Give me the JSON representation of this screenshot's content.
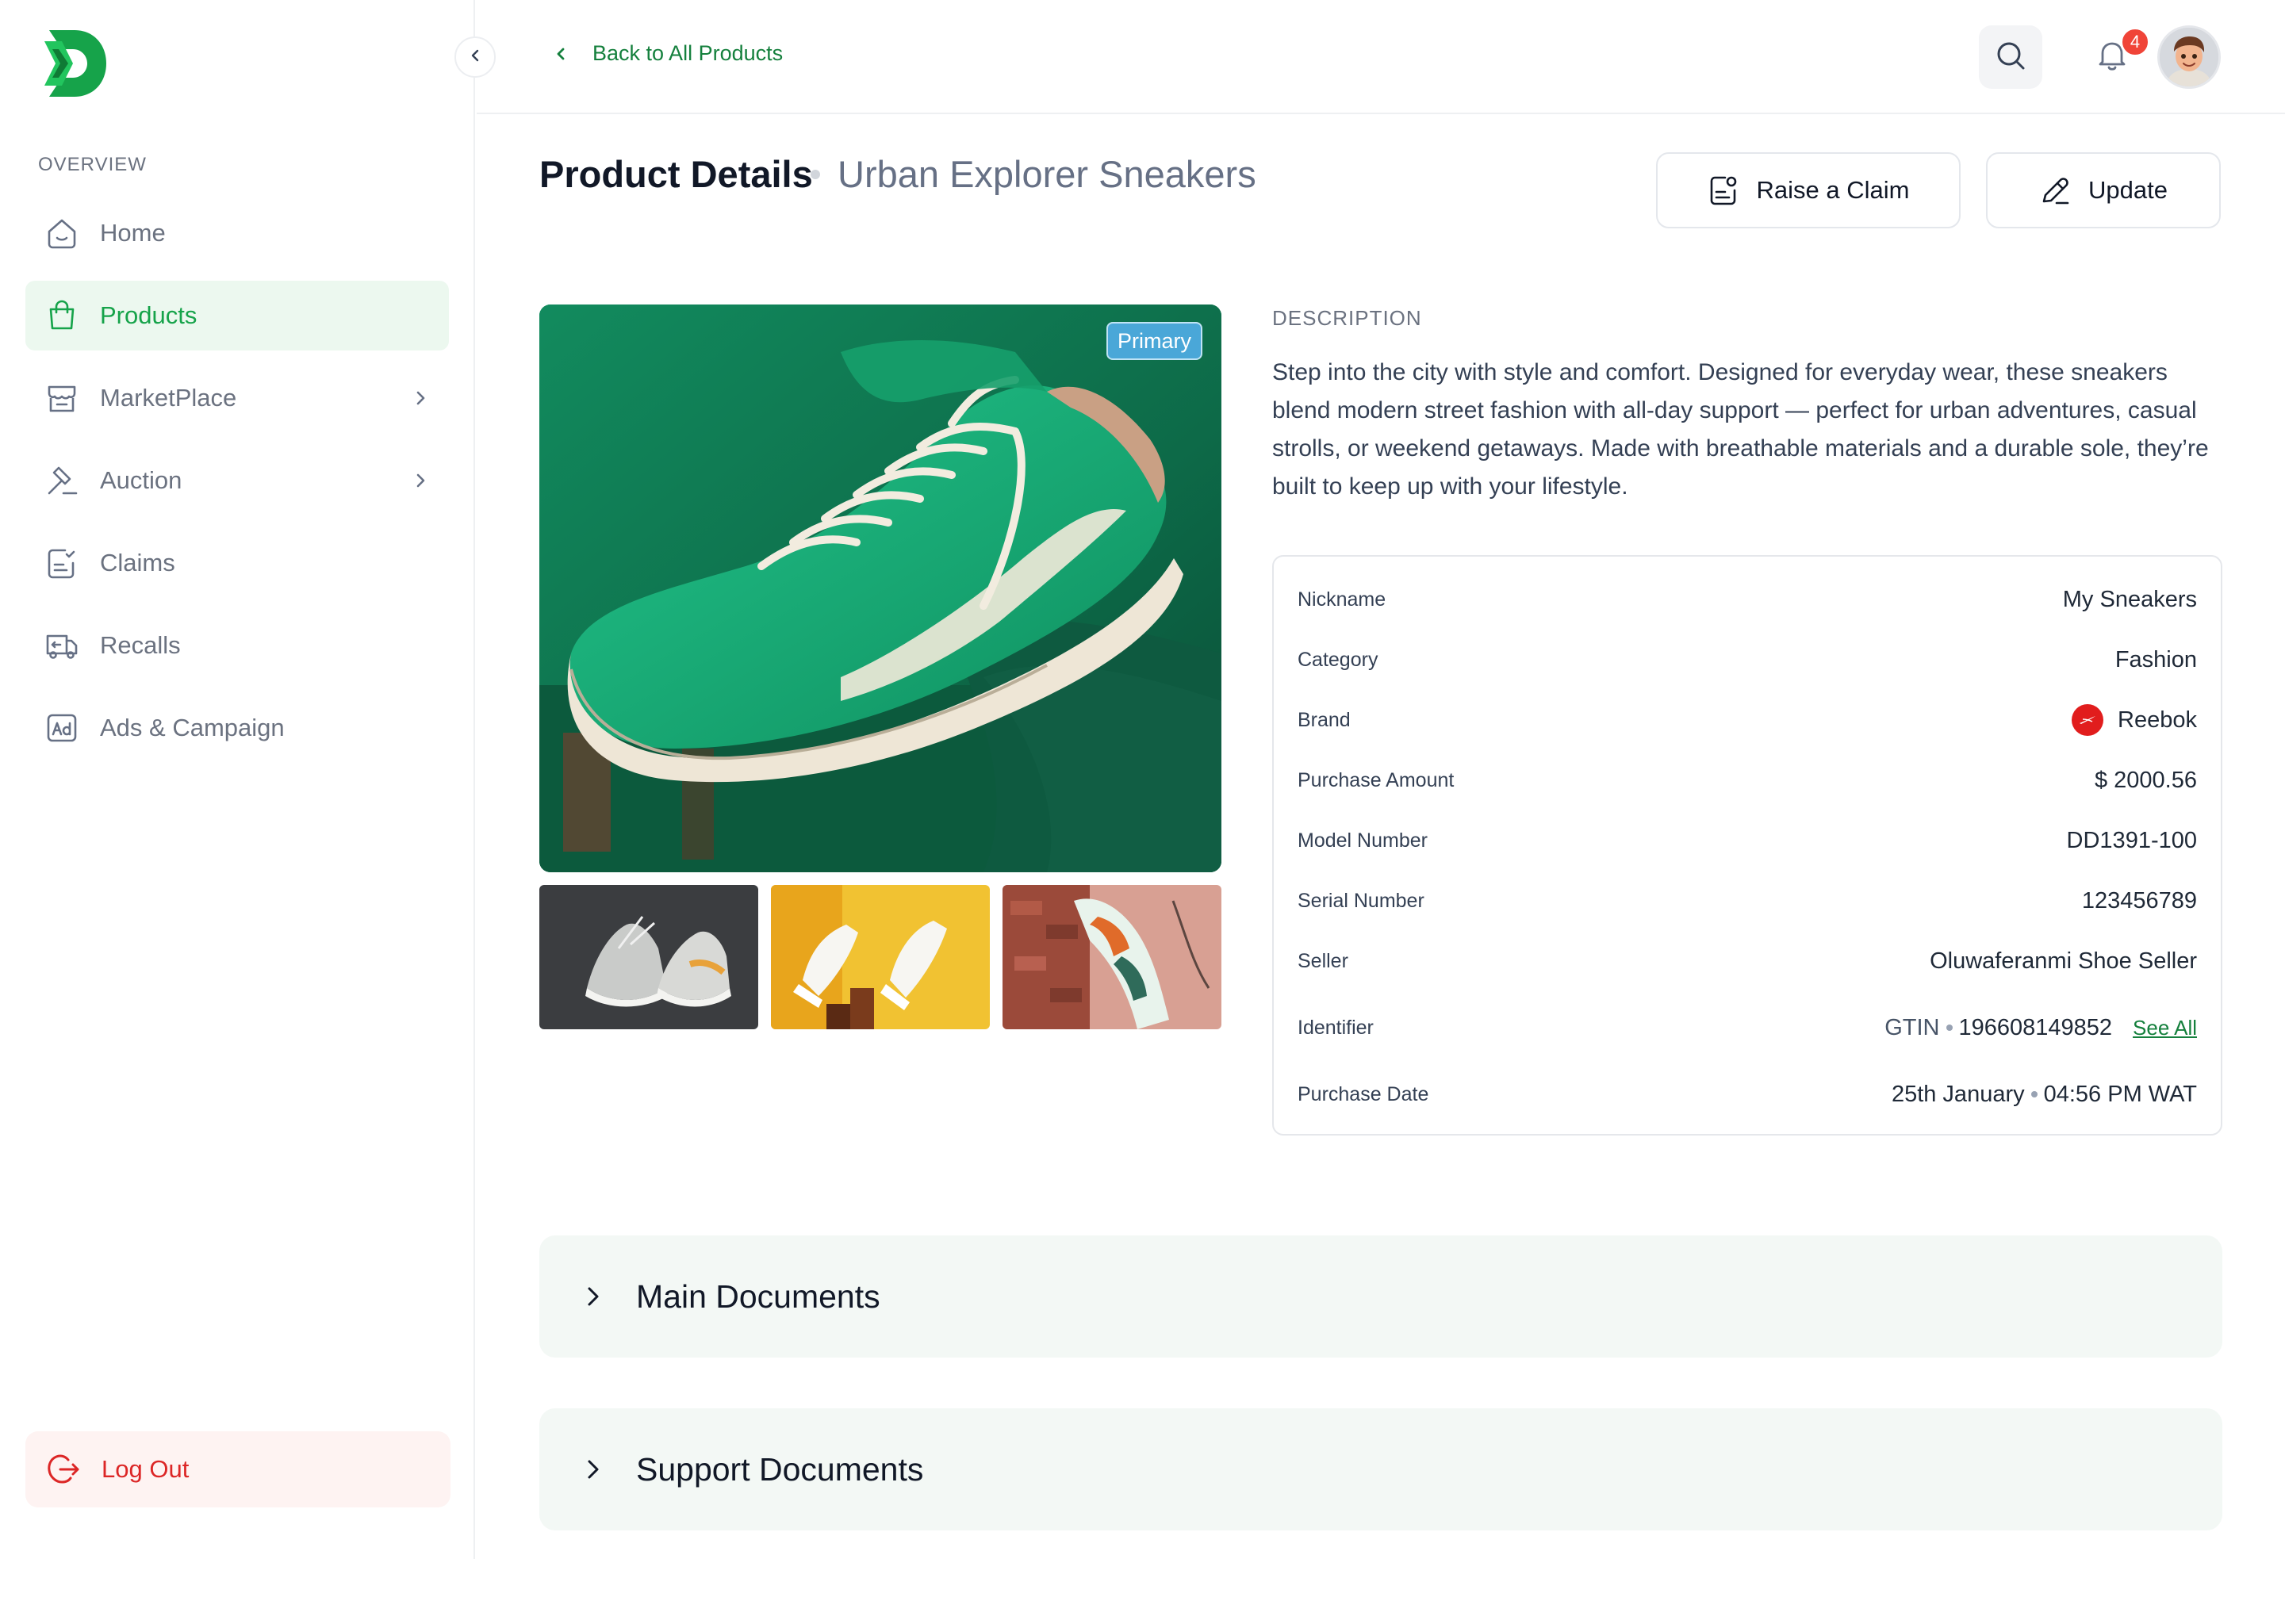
{
  "sidebar": {
    "section_label": "OVERVIEW",
    "items": [
      {
        "label": "Home"
      },
      {
        "label": "Products"
      },
      {
        "label": "MarketPlace"
      },
      {
        "label": "Auction"
      },
      {
        "label": "Claims"
      },
      {
        "label": "Recalls"
      },
      {
        "label": "Ads & Campaign"
      }
    ],
    "active": "Products",
    "logout_label": "Log Out"
  },
  "topbar": {
    "back_label": "Back to All Products",
    "notification_count": "4"
  },
  "page": {
    "title": "Product Details",
    "subtitle": "Urban Explorer Sneakers",
    "claim_label": "Raise a Claim",
    "update_label": "Update"
  },
  "gallery": {
    "primary_tag": "Primary"
  },
  "description": {
    "label": "DESCRIPTION",
    "text": "Step into the city with style and comfort. Designed for everyday wear, these sneakers blend modern street fashion with all-day support — perfect for urban adventures, casual strolls, or weekend getaways. Made with breathable materials and a durable sole, they’re built to keep up with your lifestyle."
  },
  "details": {
    "nickname": {
      "key": "Nickname",
      "value": "My Sneakers"
    },
    "category": {
      "key": "Category",
      "value": "Fashion"
    },
    "brand": {
      "key": "Brand",
      "value": "Reebok"
    },
    "purchase_amount": {
      "key": "Purchase Amount",
      "value": "$ 2000.56"
    },
    "model_number": {
      "key": "Model Number",
      "value": "DD1391-100"
    },
    "serial_number": {
      "key": "Serial Number",
      "value": "123456789"
    },
    "seller": {
      "key": "Seller",
      "value": "Oluwaferanmi Shoe Seller"
    },
    "identifier": {
      "key": "Identifier",
      "type": "GTIN",
      "value": "196608149852",
      "see_all": "See All"
    },
    "purchase_date": {
      "key": "Purchase Date",
      "date": "25th January",
      "time": "04:56 PM WAT"
    }
  },
  "accordions": {
    "main": "Main Documents",
    "support": "Support Documents"
  },
  "colors": {
    "accent": "#16a34a",
    "active_bg": "#ecf8ef",
    "logout": "#dc2626",
    "badge": "#f04438"
  }
}
